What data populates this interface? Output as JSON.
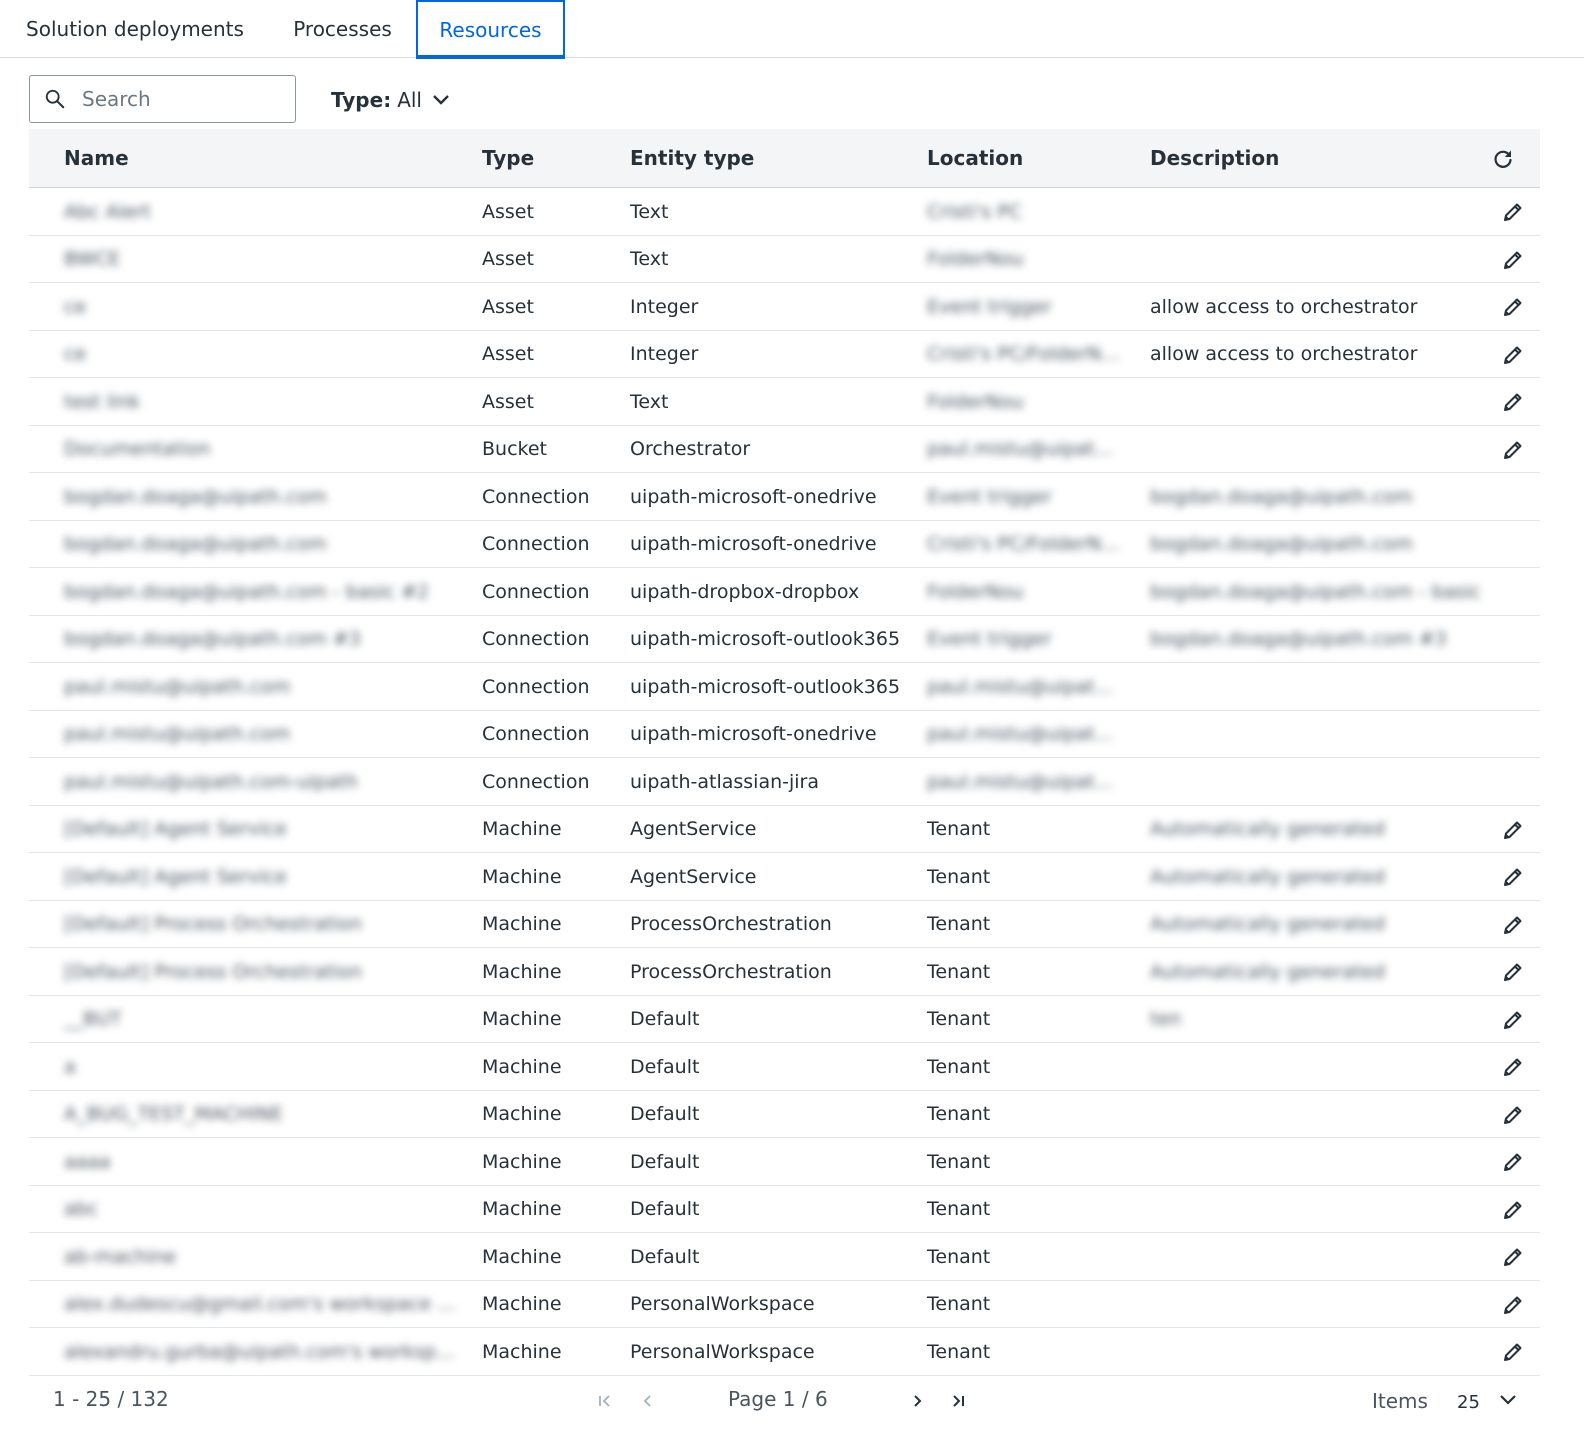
{
  "tabs": [
    {
      "label": "Solution deployments",
      "active": false
    },
    {
      "label": "Processes",
      "active": false
    },
    {
      "label": "Resources",
      "active": true
    }
  ],
  "toolbar": {
    "search_placeholder": "Search",
    "search_icon": "search-icon",
    "type_filter_label": "Type:",
    "type_filter_value": "All"
  },
  "table": {
    "columns": [
      "Name",
      "Type",
      "Entity type",
      "Location",
      "Description"
    ],
    "rows": [
      {
        "name": "Abc Alert",
        "type": "Asset",
        "entity_type": "Text",
        "location": "Cristi's PC",
        "description": "",
        "editable": true
      },
      {
        "name": "BWCE",
        "type": "Asset",
        "entity_type": "Text",
        "location": "FolderNou",
        "description": "",
        "editable": true
      },
      {
        "name": "ce",
        "type": "Asset",
        "entity_type": "Integer",
        "location": "Event trigger",
        "description": "allow access to orchestrator",
        "editable": true
      },
      {
        "name": "ce",
        "type": "Asset",
        "entity_type": "Integer",
        "location": "Cristi's PC/FolderN...",
        "description": "allow access to orchestrator",
        "editable": true
      },
      {
        "name": "test link",
        "type": "Asset",
        "entity_type": "Text",
        "location": "FolderNou",
        "description": "",
        "editable": true
      },
      {
        "name": "Documentation",
        "type": "Bucket",
        "entity_type": "Orchestrator",
        "location": "paul.mistu@uipat...",
        "description": "",
        "editable": true
      },
      {
        "name": "bogdan.doaga@uipath.com",
        "type": "Connection",
        "entity_type": "uipath-microsoft-onedrive",
        "location": "Event trigger",
        "description": "bogdan.doaga@uipath.com",
        "editable": false
      },
      {
        "name": "bogdan.doaga@uipath.com",
        "type": "Connection",
        "entity_type": "uipath-microsoft-onedrive",
        "location": "Cristi's PC/FolderN...",
        "description": "bogdan.doaga@uipath.com",
        "editable": false
      },
      {
        "name": "bogdan.doaga@uipath.com - basic #2",
        "type": "Connection",
        "entity_type": "uipath-dropbox-dropbox",
        "location": "FolderNou",
        "description": "bogdan.doaga@uipath.com - basic",
        "editable": false
      },
      {
        "name": "bogdan.doaga@uipath.com #3",
        "type": "Connection",
        "entity_type": "uipath-microsoft-outlook365",
        "location": "Event trigger",
        "description": "bogdan.doaga@uipath.com #3",
        "editable": false
      },
      {
        "name": "paul.mistu@uipath.com",
        "type": "Connection",
        "entity_type": "uipath-microsoft-outlook365",
        "location": "paul.mistu@uipat...",
        "description": "",
        "editable": false
      },
      {
        "name": "paul.mistu@uipath.com",
        "type": "Connection",
        "entity_type": "uipath-microsoft-onedrive",
        "location": "paul.mistu@uipat...",
        "description": "",
        "editable": false
      },
      {
        "name": "paul.mistu@uipath.com-uipath",
        "type": "Connection",
        "entity_type": "uipath-atlassian-jira",
        "location": "paul.mistu@uipat...",
        "description": "",
        "editable": false
      },
      {
        "name": "[Default] Agent Service",
        "type": "Machine",
        "entity_type": "AgentService",
        "location": "Tenant",
        "description": "Automatically generated",
        "editable": true
      },
      {
        "name": "[Default] Agent Service",
        "type": "Machine",
        "entity_type": "AgentService",
        "location": "Tenant",
        "description": "Automatically generated",
        "editable": true
      },
      {
        "name": "[Default] Process Orchestration",
        "type": "Machine",
        "entity_type": "ProcessOrchestration",
        "location": "Tenant",
        "description": "Automatically generated",
        "editable": true
      },
      {
        "name": "[Default] Process Orchestration",
        "type": "Machine",
        "entity_type": "ProcessOrchestration",
        "location": "Tenant",
        "description": "Automatically generated",
        "editable": true
      },
      {
        "name": "__BUT",
        "type": "Machine",
        "entity_type": "Default",
        "location": "Tenant",
        "description": "ten",
        "editable": true
      },
      {
        "name": "a",
        "type": "Machine",
        "entity_type": "Default",
        "location": "Tenant",
        "description": "",
        "editable": true
      },
      {
        "name": "A_BUG_TEST_MACHINE",
        "type": "Machine",
        "entity_type": "Default",
        "location": "Tenant",
        "description": "",
        "editable": true
      },
      {
        "name": "aaaa",
        "type": "Machine",
        "entity_type": "Default",
        "location": "Tenant",
        "description": "",
        "editable": true
      },
      {
        "name": "abc",
        "type": "Machine",
        "entity_type": "Default",
        "location": "Tenant",
        "description": "",
        "editable": true
      },
      {
        "name": "ab-machine",
        "type": "Machine",
        "entity_type": "Default",
        "location": "Tenant",
        "description": "",
        "editable": true
      },
      {
        "name": "alex.dudescu@gmail.com's workspace ...",
        "type": "Machine",
        "entity_type": "PersonalWorkspace",
        "location": "Tenant",
        "description": "",
        "editable": true
      },
      {
        "name": "alexandru.gurba@uipath.com's worksp...",
        "type": "Machine",
        "entity_type": "PersonalWorkspace",
        "location": "Tenant",
        "description": "",
        "editable": true
      }
    ]
  },
  "footer": {
    "range": "1 - 25 / 132",
    "page_label": "Page 1 / 6",
    "items_label": "Items",
    "items_value": "25"
  },
  "colors": {
    "accent": "#0067df",
    "header_bg": "#f4f5f7",
    "text": "#273139"
  }
}
